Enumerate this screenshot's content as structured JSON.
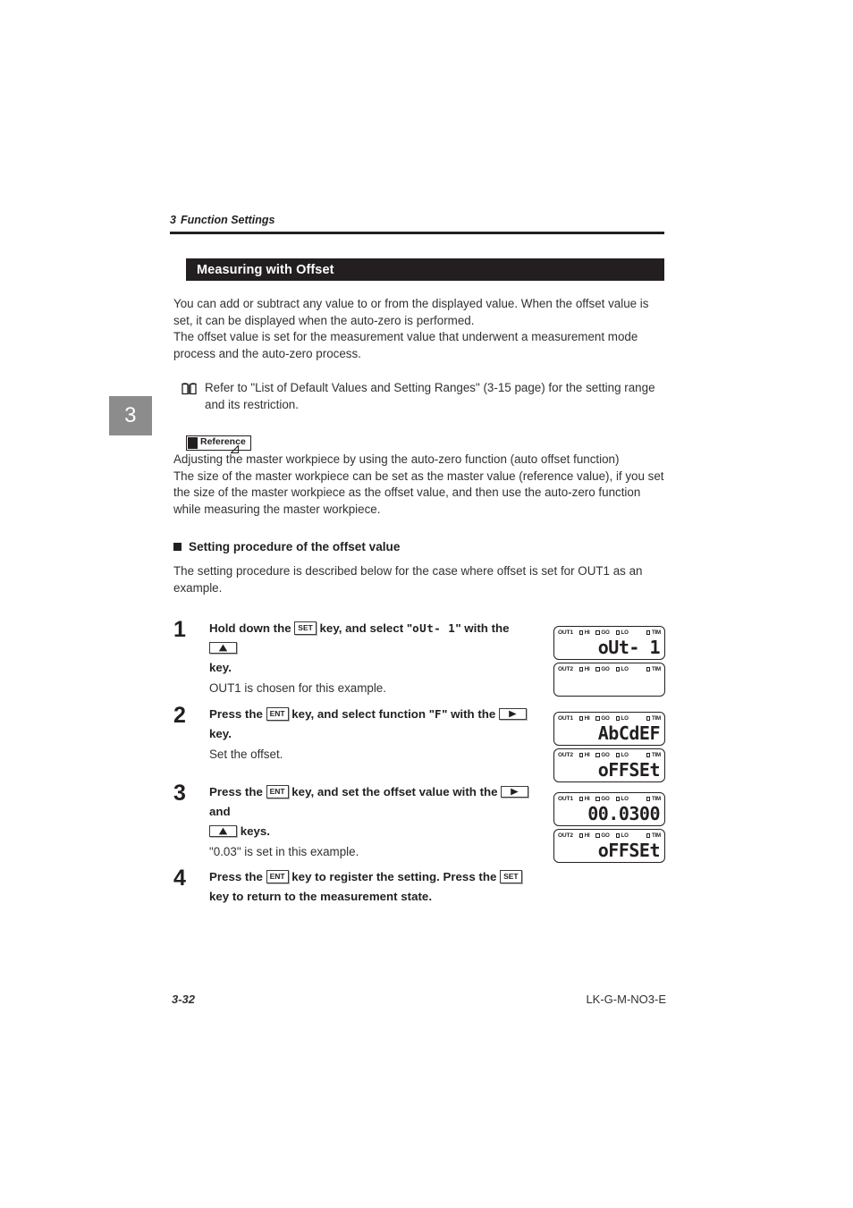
{
  "chapter_tab": "3",
  "running_head": {
    "number": "3",
    "title": "Function Settings"
  },
  "section_title": "Measuring with Offset",
  "intro": {
    "p1": "You can add or subtract any value to or from the displayed value. When the offset value is set, it can be displayed when the auto-zero is performed.",
    "p2": "The offset value is set for the measurement value that underwent a measurement mode process and the auto-zero process."
  },
  "note": {
    "icon": "book-icon",
    "text": "Refer to \"List of Default Values and Setting Ranges\" (3-15 page) for the setting range and its restriction."
  },
  "reference": {
    "label": "Reference",
    "line1": "Adjusting the master workpiece by using the auto-zero function (auto offset function)",
    "line2": "The size of the master workpiece can be set as the master value (reference value), if you set the size of the master workpiece as the offset value, and then use the auto-zero function while measuring the master workpiece."
  },
  "procedure": {
    "heading": "Setting procedure of the offset value",
    "intro": "The setting procedure is described below for the case where offset is set for OUT1 as an example."
  },
  "steps": [
    {
      "number": "1",
      "text_before_key1": "Hold down the",
      "key1": "SET",
      "text_mid": "key, and select \"",
      "segment_value": "oUt- 1",
      "text_after_segment": "\" with the",
      "key2": "up-arrow",
      "text_end": "key.",
      "sub": "OUT1 is chosen for this example."
    },
    {
      "number": "2",
      "text_before_key1": "Press the",
      "key1": "ENT",
      "text_mid": "key, and select function \"",
      "segment_value": "F",
      "text_after_segment": "\" with the",
      "key2": "right-arrow",
      "text_end": "key.",
      "sub": "Set the offset."
    },
    {
      "number": "3",
      "text_before_key1": "Press the",
      "key1": "ENT",
      "text_mid": "key, and set the offset value with the",
      "key2": "right-arrow",
      "text_and": "and",
      "key3": "up-arrow",
      "text_end": "keys.",
      "sub": "\"0.03\" is set in this example."
    },
    {
      "number": "4",
      "text_before_key1": "Press the",
      "key1": "ENT",
      "text_mid": "key to register the setting. Press the",
      "key2": "SET",
      "text_end": "key to return to the measurement state.",
      "sub": ""
    }
  ],
  "lcd_indicators": {
    "out1_label": "OUT1",
    "out2_label": "OUT2",
    "hi": "HI",
    "go": "GO",
    "lo": "LO",
    "tim": "TIM"
  },
  "lcd_panels": [
    {
      "out1_value": "oUt- 1",
      "out2_value": ""
    },
    {
      "out1_value": "AbCdEF",
      "out2_value": "oFFSEt"
    },
    {
      "out1_value": "00.0300",
      "out2_value": "oFFSEt"
    }
  ],
  "footer": {
    "page": "3-32",
    "code": "LK-G-M-NO3-E"
  }
}
